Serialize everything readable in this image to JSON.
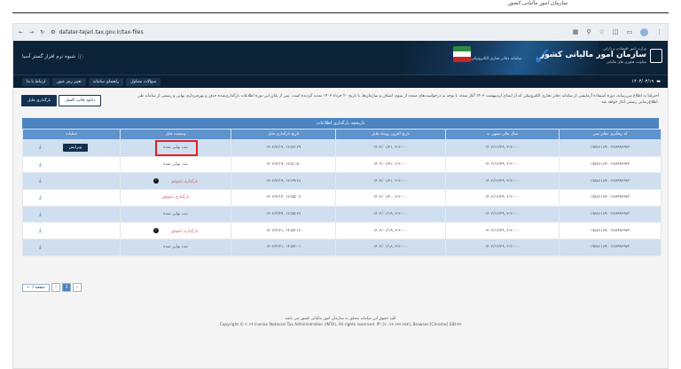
{
  "doc": {
    "header_title": "سازمان امور مالیاتی کشور"
  },
  "browser": {
    "url": "dafater-tejari.tax.gov.ir/tax-files"
  },
  "header": {
    "support": "شیوه نرم افزار گستر آسیا",
    "system_name": "سامانه دفاتر تجاری الکترونیکی",
    "ministry": "وزارت امور اقتصادی و دارایی",
    "org_name": "سازمان امور مالیاتی کشور",
    "deputy": "معاونت فناوری های مالیاتی"
  },
  "nav": {
    "menu": [
      "ارتباط با ما",
      "تغییر رمز عبور",
      "راهنمای سامانه",
      "سوالات متداول"
    ],
    "date": "۱۴۰۳/۰۳/۱۹"
  },
  "notice": "احتراما به اطلاع می‌رساند، دوره استفاده آزمایشی از سامانه دفاتر تجاری الکترونیکی که از ابتدای اردیبهشت ۱۴۰۳ آغاز شده، با توجه به درخواست‌های متعدد از سوی اصناف و سازمان‌ها، تا تاریخ ۲۰ خرداد ۱۴۰۳ تمدید گردیده است. پس از پایان این دوره اطلاعات بارگذاری‌شده حذف و بهره‌برداری نهایی و رسمی از سامانه طی اطلاع‌رسانی رسمی آغاز خواهد شد.",
  "buttons": {
    "upload": "بارگذاری فایل",
    "download_template": "دانلود قالب اکسل"
  },
  "table": {
    "title": "تاریخچه بارگذاری اطلاعات",
    "columns": [
      "کد رهگیری دفاتر ثبتی",
      "سال مالی منتهی به",
      "تاریخ آخرین رویداد فایل",
      "تاریخ بارگذاری فایل",
      "وضعیت فایل",
      "عملیات"
    ],
    "edit_label": "ویرایش",
    "rows": [
      {
        "code": "۱۷۵۸۶۱۸۹۰۰۲۸۷۹۹۶۹۳۲",
        "year": "۱۴۰۲/۱۲/۲۹, ۳:۳۰:۰۰",
        "last": "۱۴۰۲/۰۱/۳۱, ۳:۳۰:۰۰",
        "upload": "۱۴۰۳/۳/۱۹, ۱۳:۵۲:۳۹",
        "status": "ثبت نهایی شده",
        "state": "final-hl"
      },
      {
        "code": "۱۷۵۸۶۱۸۹۰۰۲۸۷۹۹۶۹۳۲",
        "year": "۱۴۰۲/۱۲/۲۹, ۳:۳۰:۰۰",
        "last": "۱۴۰۲/۰۱/۳۱, ۳:۳۰:۰۰",
        "upload": "۱۴۰۳/۳/۱۹, ۱۳:۵۱:۵۰",
        "status": "ثبت نهایی شده",
        "state": "final"
      },
      {
        "code": "۱۷۵۸۶۱۸۹۰۰۲۸۷۹۹۶۹۳۲",
        "year": "۱۴۰۲/۱۲/۲۹, ۳:۳۰:۰۰",
        "last": "۱۴۰۲/۰۱/۳۱, ۳:۳۰:۰۰",
        "upload": "۱۴۰۳/۳/۱۹, ۱۳:۳۹:۲۸",
        "status": "بارگذاری ناموفق",
        "state": "fail"
      },
      {
        "code": "۱۷۵۸۶۱۸۹۰۰۲۸۷۹۹۶۹۳۲",
        "year": "۱۴۰۲/۱۲/۲۹, ۳:۳۰:۰۰",
        "last": "۱۴۰۲/۰۱/۲۰, ۳:۳۰:۰۰",
        "upload": "۱۴۰۳/۳/۱۴, ۱۳:۵۵:۰۷",
        "status": "بارگذاری ناموفق",
        "state": "fail"
      },
      {
        "code": "۱۷۵۸۶۱۸۹۰۰۲۸۷۹۹۶۹۳۲",
        "year": "۱۴۰۲/۱۲/۲۹, ۳:۳۰:۰۰",
        "last": "۱۴۰۲/۰۱/۱۹, ۳:۳۰:۰۰",
        "upload": "۱۴۰۳/۲/۲۹, ۱۳:۵۵:۳۷",
        "status": "ثبت نهایی شده",
        "state": "final"
      },
      {
        "code": "۱۷۵۸۶۱۸۹۰۰۲۸۷۹۹۶۹۳۲",
        "year": "۱۴۰۲/۱۲/۲۹, ۳:۳۰:۰۰",
        "last": "۱۴۰۲/۰۱/۱۹, ۳:۳۰:۰۰",
        "upload": "۱۴۰۳/۲/۲۱, ۱۴:۵۴:۱۳",
        "status": "بارگذاری ناموفق",
        "state": "fail"
      },
      {
        "code": "۱۷۵۸۶۱۸۹۰۰۲۸۷۹۹۶۹۳۲",
        "year": "۱۴۰۲/۱۲/۲۹, ۳:۳۰:۰۰",
        "last": "۱۴۰۲/۰۱/۱۸, ۳:۳۰:۰۰",
        "upload": "۱۴۰۳/۲/۲۱, ۱۴:۵۴:۰۱",
        "status": "ثبت نهایی شده",
        "state": "final"
      }
    ]
  },
  "pager": {
    "page_size": "۱۰ / صفحه",
    "page": "1",
    "prev": "‹",
    "next": "›"
  },
  "footer": {
    "line1": "کلیه حقوق این سامانه متعلق به سازمان امور مالیاتی کشور می باشد",
    "line2": "Copyright © ۲۰۲۴ Iranian National Tax Administration (INTA). All rights reserved. IP: [۲۰.۲۳.۲۳۳.۲۵۴], Browser:[Chrome] SID:۴۳"
  },
  "colors": {
    "header": "#0c2237",
    "accent": "#4b84c0",
    "error": "#d54c4c",
    "highlight": "#e11f1f"
  }
}
